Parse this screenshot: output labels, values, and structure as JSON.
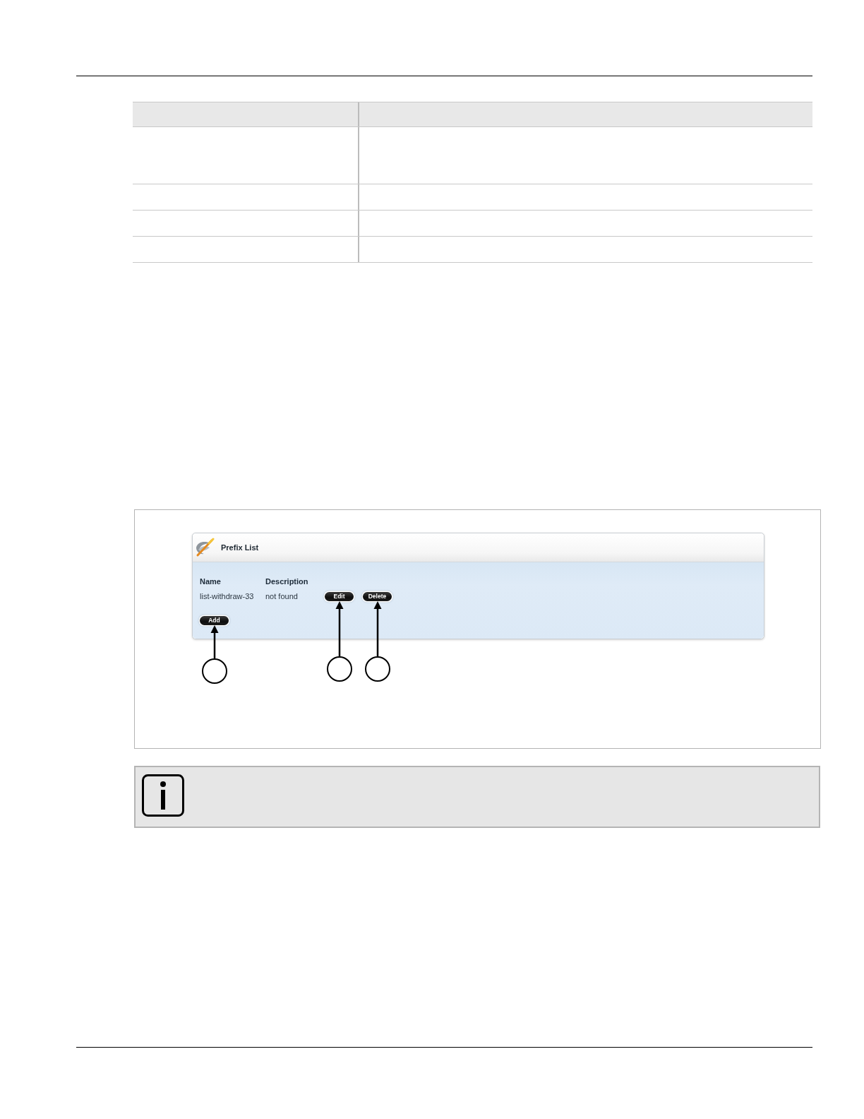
{
  "table": {
    "rows": [
      {
        "kind": "header"
      },
      {
        "kind": "tall"
      },
      {
        "kind": "plain"
      },
      {
        "kind": "plain"
      },
      {
        "kind": "plain"
      }
    ]
  },
  "figure": {
    "panel": {
      "title": "Prefix List",
      "columns": [
        "Name",
        "Description"
      ],
      "rows": [
        {
          "cells": [
            "list-withdraw-33",
            "not found"
          ],
          "buttons": [
            {
              "label": "Edit",
              "callout": true
            },
            {
              "label": "Delete",
              "callout": true
            }
          ]
        }
      ],
      "add_button": {
        "label": "Add",
        "callout": true
      }
    }
  },
  "note": {
    "kind": "info"
  }
}
